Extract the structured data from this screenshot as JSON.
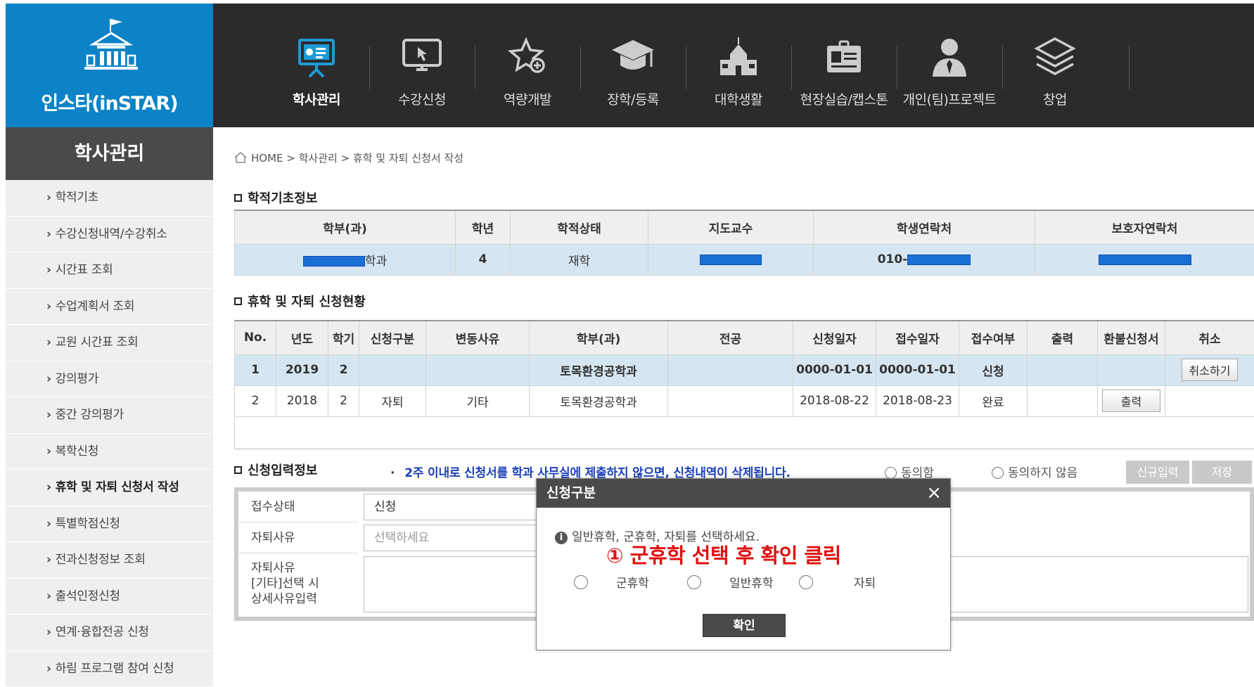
{
  "logo": {
    "title": "인스타(inSTAR)"
  },
  "nav": {
    "items": [
      {
        "label": "학사관리",
        "icon": "presentation-board-icon"
      },
      {
        "label": "수강신청",
        "icon": "monitor-cursor-icon"
      },
      {
        "label": "역량개발",
        "icon": "star-plus-icon"
      },
      {
        "label": "장학/등록",
        "icon": "graduation-cap-icon"
      },
      {
        "label": "대학생활",
        "icon": "school-building-icon"
      },
      {
        "label": "현장실습/캡스톤",
        "icon": "id-card-icon"
      },
      {
        "label": "개인(팀)프로젝트",
        "icon": "person-suit-icon"
      },
      {
        "label": "창업",
        "icon": "layers-icon"
      }
    ]
  },
  "sidebar": {
    "title": "학사관리",
    "items": [
      "학적기초",
      "수강신청내역/수강취소",
      "시간표 조회",
      "수업계획서 조회",
      "교원 시간표 조회",
      "강의평가",
      "중간 강의평가",
      "복학신청",
      "휴학 및 자퇴 신청서 작성",
      "특별학점신청",
      "전과신청정보 조회",
      "출석인정신청",
      "연계·융합전공 신청",
      "하림 프로그램 참여 신청"
    ]
  },
  "breadcrumb": "HOME > 학사관리 > 휴학 및 자퇴 신청서 작성",
  "basic": {
    "title": "학적기초정보",
    "headers": [
      "학부(과)",
      "학년",
      "학적상태",
      "지도교수",
      "학생연락처",
      "보호자연락처"
    ],
    "row": {
      "dept_suffix": "학과",
      "year": "4",
      "status": "재학",
      "phone_prefix": "010-"
    }
  },
  "apps": {
    "title": "휴학 및 자퇴 신청현황",
    "headers": [
      "No.",
      "년도",
      "학기",
      "신청구분",
      "변동사유",
      "학부(과)",
      "전공",
      "신청일자",
      "접수일자",
      "접수여부",
      "출력",
      "환불신청서",
      "취소"
    ],
    "rows": [
      {
        "no": "1",
        "year": "2019",
        "term": "2",
        "kind": "",
        "reason": "",
        "dept": "토목환경공학과",
        "major": "",
        "apply_date": "0000-01-01",
        "recv_date": "0000-01-01",
        "recv_status": "신청",
        "print": "",
        "refund": "",
        "cancel": "취소하기"
      },
      {
        "no": "2",
        "year": "2018",
        "term": "2",
        "kind": "자퇴",
        "reason": "기타",
        "dept": "토목환경공학과",
        "major": "",
        "apply_date": "2018-08-22",
        "recv_date": "2018-08-23",
        "recv_status": "완료",
        "print": "",
        "refund": "출력",
        "cancel": ""
      }
    ]
  },
  "input_section": {
    "title": "신청입력정보",
    "notice": "2주 이내로 신청서를 학과 사무실에 제출하지 않으면, 신청내역이 삭제됩니다.",
    "agree": "동의함",
    "disagree": "동의하지 않음",
    "new_button": "신규입력",
    "save_button": "저장",
    "fields": {
      "recv_label": "접수상태",
      "recv_value": "신청",
      "reason_label": "자퇴사유",
      "reason_placeholder": "선택하세요",
      "detail_label": "자퇴사유\n[기타]선택 시\n상세사유입력"
    }
  },
  "modal": {
    "title": "신청구분",
    "close": "×",
    "message": "일반휴학, 군휴학, 자퇴를 선택하세요.",
    "annotation": "① 군휴학 선택 후 확인 클릭",
    "options": [
      "군휴학",
      "일반휴학",
      "자퇴"
    ],
    "ok": "확인"
  },
  "colors": {
    "brand": "#0c83c6",
    "nav_bg": "#2b2b2b",
    "highlight_row": "#d5e6f2",
    "notice": "#1a3fb5",
    "annotation": "#e01010",
    "mask": "#1a6fd6"
  }
}
